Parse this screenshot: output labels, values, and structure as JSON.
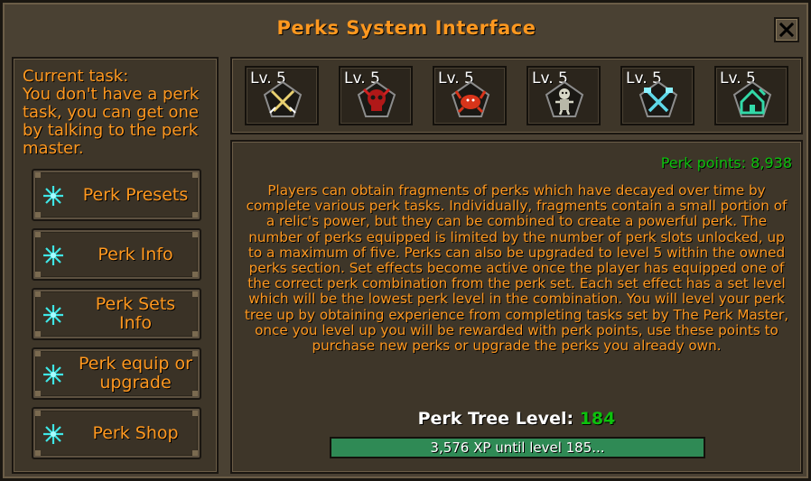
{
  "window": {
    "title": "Perks System Interface",
    "close_icon": "close-icon"
  },
  "left_panel": {
    "task_heading": "Current task:",
    "task_body": "You don't have a perk task, you can get one by talking to the perk master.",
    "buttons": [
      {
        "label": "Perk Presets",
        "icon": "star-icon"
      },
      {
        "label": "Perk Info",
        "icon": "star-icon"
      },
      {
        "label": "Perk Sets Info",
        "icon": "star-icon"
      },
      {
        "label": "Perk equip or upgrade",
        "icon": "star-icon"
      },
      {
        "label": "Perk Shop",
        "icon": "star-icon"
      }
    ]
  },
  "perk_slots": [
    {
      "level": "Lv. 5",
      "icon": "crossed-swords-icon"
    },
    {
      "level": "Lv. 5",
      "icon": "red-skull-icon"
    },
    {
      "level": "Lv. 5",
      "icon": "red-crab-icon"
    },
    {
      "level": "Lv. 5",
      "icon": "skeleton-icon"
    },
    {
      "level": "Lv. 5",
      "icon": "crossed-tools-icon"
    },
    {
      "level": "Lv. 5",
      "icon": "house-icon"
    }
  ],
  "info": {
    "perk_points": "Perk points: 8,938",
    "description": "Players can obtain fragments of perks which have decayed over time by complete various perk tasks. Individually, fragments contain a small portion of a relic's power, but they can be combined to create a powerful perk. The number of perks equipped is limited by the number of perk slots unlocked, up to a maximum of five. Perks can also be upgraded to level 5 within the owned perks section. Set effects become active once the player has equipped one of the correct perk combination from the perk set. Each set effect has a set level which will be the lowest perk level in the combination. You will level your perk tree up by obtaining experience from completing tasks set by The Perk Master, once you level up you will be rewarded with perk points, use these points to purchase new perks or upgrade the perks you already own.",
    "tree_level_label": "Perk Tree Level:",
    "tree_level_value": "184",
    "xp_text": "3,576 XP until level 185...",
    "xp_progress": 1.0
  },
  "colors": {
    "accent_orange": "#ff981f",
    "green": "#0dc10d",
    "xp_bar": "#2f8a55",
    "background": "#4a4133"
  }
}
